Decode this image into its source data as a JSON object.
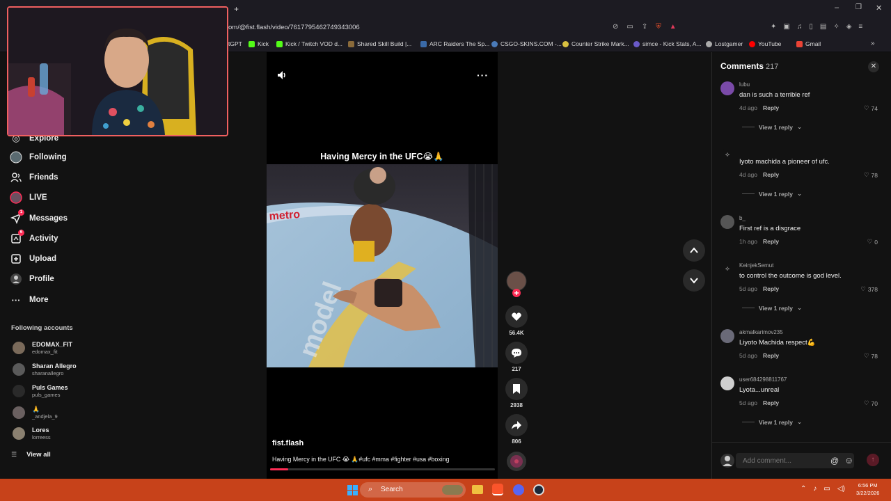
{
  "browser": {
    "url": "om/@fist.flash/video/7617795462749343006",
    "bookmarks": [
      {
        "label": "tGPT",
        "color": "#1c1b22"
      },
      {
        "label": "Kick",
        "color": "#53fc18"
      },
      {
        "label": "Kick / Twitch VOD d...",
        "color": "#53fc18"
      },
      {
        "label": "Shared Skill Build |...",
        "color": "#8a6a3a"
      },
      {
        "label": "ARC Raiders The Sp...",
        "color": "#3a6aa8"
      },
      {
        "label": "CSGO-SKINS.COM -...",
        "color": "#4a7ab8"
      },
      {
        "label": "Counter Strike Mark...",
        "color": "#d8c040"
      },
      {
        "label": "simce - Kick Stats, A...",
        "color": "#6a5ac8"
      },
      {
        "label": "Lostgamer",
        "color": "#aaaaaa"
      },
      {
        "label": "YouTube",
        "color": "#ff0000"
      },
      {
        "label": "Gmail",
        "color": "#ea4335"
      }
    ]
  },
  "nav": {
    "explore": "Explore",
    "following": "Following",
    "friends": "Friends",
    "live": "LIVE",
    "messages": "Messages",
    "messages_badge": "1",
    "activity": "Activity",
    "activity_badge": "6",
    "upload": "Upload",
    "profile": "Profile",
    "more": "More"
  },
  "following_accounts": {
    "title": "Following accounts",
    "items": [
      {
        "name": "EDOMAX_FIT",
        "username": "edomax_fit"
      },
      {
        "name": "Sharan Allegro",
        "username": "sharanallegro"
      },
      {
        "name": "Puls Games",
        "username": "puls_games"
      },
      {
        "name": "🙏",
        "username": "_andjela_9"
      },
      {
        "name": "Lores",
        "username": "lorreess"
      }
    ],
    "view_all": "View all"
  },
  "video": {
    "title": "Having Mercy in the UFC😭🙏",
    "author": "fist.flash",
    "caption": "Having Mercy in the UFC 😭 🙏#ufc #mma #fighter #usa #boxing",
    "progress": 0.08
  },
  "actions": {
    "likes": "56.4K",
    "comments": "217",
    "saves": "2938",
    "shares": "806"
  },
  "comments": {
    "title": "Comments",
    "count": "217",
    "items": [
      {
        "user": "lubu",
        "text": "dan is such a terrible ref",
        "time": "4d ago",
        "reply": "Reply",
        "likes": "74",
        "view_replies": "View 1 reply",
        "avatar_color": "#7a4aa8"
      },
      {
        "user": "",
        "text": "Iyoto machida a pioneer of ufc.",
        "time": "4d ago",
        "reply": "Reply",
        "likes": "78",
        "view_replies": "View 1 reply",
        "avatar_color": "#121212"
      },
      {
        "user": "b_",
        "text": "First ref is a disgrace",
        "time": "1h ago",
        "reply": "Reply",
        "likes": "0",
        "view_replies": "",
        "avatar_color": "#555555"
      },
      {
        "user": "KeinjekSemut",
        "text": "to control the outcome is god level.",
        "time": "5d ago",
        "reply": "Reply",
        "likes": "378",
        "view_replies": "View 1 reply",
        "avatar_color": "#121212"
      },
      {
        "user": "akmalkarimov235",
        "text": "Liyoto Machida respect💪",
        "time": "5d ago",
        "reply": "Reply",
        "likes": "78",
        "view_replies": "",
        "avatar_color": "#6a6a78"
      },
      {
        "user": "user684298811767",
        "text": "Lyota...unreal",
        "time": "5d ago",
        "reply": "Reply",
        "likes": "70",
        "view_replies": "View 1 reply",
        "avatar_color": "#cfcfcf"
      }
    ],
    "add_placeholder": "Add comment..."
  },
  "taskbar": {
    "search_label": "Search",
    "time": "6:56 PM",
    "date": "3/22/2026"
  }
}
